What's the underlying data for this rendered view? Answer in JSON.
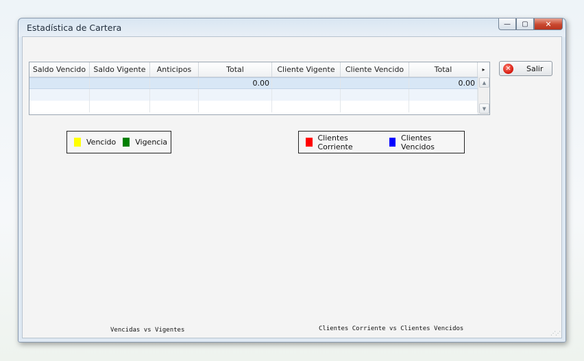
{
  "window": {
    "title": "Estadística de Cartera"
  },
  "caption_buttons": {
    "minimize": "—",
    "maximize": "▢",
    "close": "✕"
  },
  "grid": {
    "columns": [
      "Saldo Vencido",
      "Saldo Vigente",
      "Anticipos",
      "Total",
      "Cliente Vigente",
      "Cliente Vencido",
      "Total"
    ],
    "rows": [
      [
        "",
        "",
        "",
        "0.00",
        "",
        "",
        "0.00"
      ],
      [
        "",
        "",
        "",
        "",
        "",
        "",
        ""
      ],
      [
        "",
        "",
        "",
        "",
        "",
        "",
        ""
      ]
    ]
  },
  "buttons": {
    "salir": "Salir"
  },
  "legend1": {
    "items": [
      {
        "label": "Vencido",
        "color": "#ffff00"
      },
      {
        "label": "Vigencia",
        "color": "#008000"
      }
    ]
  },
  "legend2": {
    "items": [
      {
        "label": "Clientes Corriente",
        "color": "#ff0000"
      },
      {
        "label": "Clientes Vencidos",
        "color": "#0000ff"
      }
    ]
  },
  "charts": {
    "left_title": "Vencidas vs Vigentes",
    "right_title": "Clientes Corriente vs Clientes Vencidos"
  }
}
